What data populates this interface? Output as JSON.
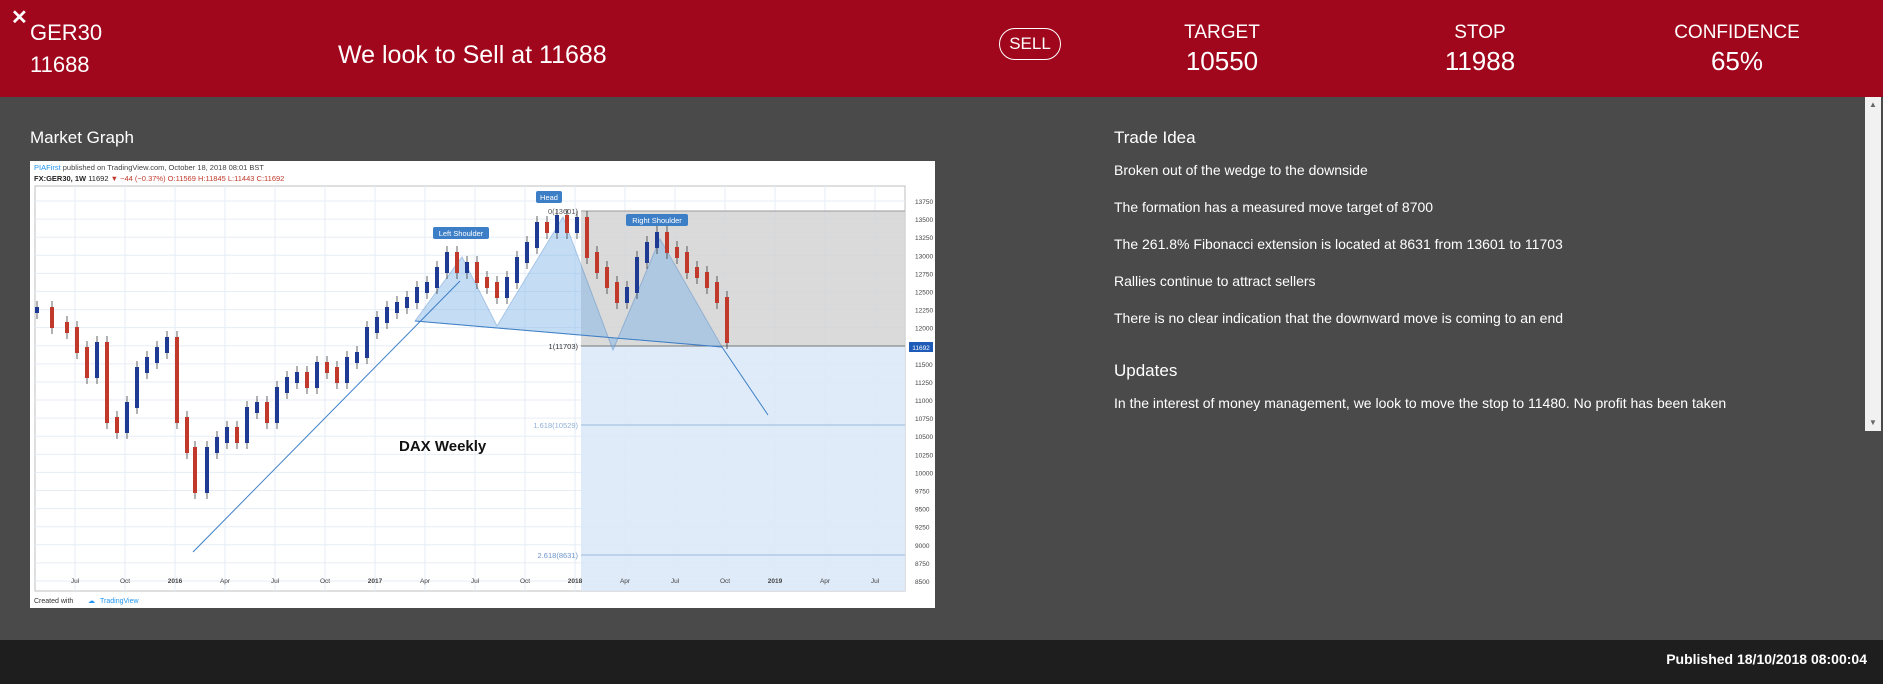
{
  "header": {
    "close_icon": "close-icon",
    "instrument": "GER30",
    "price": "11688",
    "headline": "We look to Sell at 11688",
    "direction": "SELL",
    "target_label": "TARGET",
    "target_value": "10550",
    "stop_label": "STOP",
    "stop_value": "11988",
    "confidence_label": "CONFIDENCE",
    "confidence_value": "65%",
    "bg_color": "#a0071c"
  },
  "market_graph": {
    "title": "Market Graph",
    "chart": {
      "publisher": "PIAFirst",
      "published_line": "published on TradingView.com, October 18, 2018 08:01 BST",
      "symbol_line": "FX:GER30, 1W",
      "last": "11692",
      "change": "−44 (−0.37%)",
      "o": "O:11569",
      "h": "H:11845",
      "l": "L:11443",
      "c": "C:11692",
      "watermark": "DAX Weekly",
      "head_label": "Head",
      "left_shoulder_label": "Left Shoulder",
      "right_shoulder_label": "Right Shoulder",
      "fib_0": "0(13601)",
      "fib_1": "1(11703)",
      "fib_1618": "1.618(10529)",
      "fib_2618": "2.618(8631)",
      "price_badge": "11692",
      "created_with": "Created with",
      "tradingview": "TradingView",
      "y_ticks": [
        "13750",
        "13500",
        "13250",
        "13000",
        "12750",
        "12500",
        "12250",
        "12000",
        "11750",
        "11500",
        "11250",
        "11000",
        "10750",
        "10500",
        "10250",
        "10000",
        "9750",
        "9500",
        "9250",
        "9000",
        "8750",
        "8500"
      ],
      "x_ticks": [
        "Jul",
        "Oct",
        "2016",
        "Apr",
        "Jul",
        "Oct",
        "2017",
        "Apr",
        "Jul",
        "Oct",
        "2018",
        "Apr",
        "Jul",
        "Oct",
        "2019",
        "Apr",
        "Jul"
      ]
    }
  },
  "trade_idea": {
    "title": "Trade Idea",
    "points": [
      "Broken out of the wedge to the downside",
      "The formation has a measured move target of 8700",
      "The 261.8% Fibonacci extension is located at 8631 from 13601 to 11703",
      "Rallies continue to attract sellers",
      "There is no clear indication that the downward move is coming to an end"
    ]
  },
  "updates": {
    "title": "Updates",
    "text": "In the interest of money management, we look to move the stop to 11480. No profit has been taken"
  },
  "footer": {
    "published": "Published 18/10/2018 08:00:04"
  }
}
